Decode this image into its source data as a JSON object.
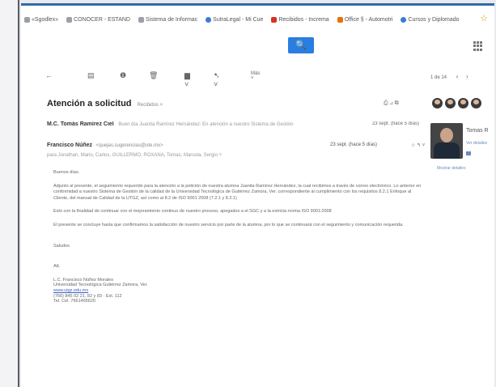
{
  "bookmarks": [
    {
      "label": "«Sgodlex»",
      "icon": "page-icon",
      "color": "#9aa0a6"
    },
    {
      "label": "CONOCER - ESTAND",
      "icon": "document-icon",
      "color": "#9aa0a6"
    },
    {
      "label": "Sistema de Informac",
      "icon": "page-icon",
      "color": "#9aa0a6"
    },
    {
      "label": "SutraLegal - Mi Cue",
      "icon": "globe-icon",
      "color": "#3c7bd4"
    },
    {
      "label": "Recibidos - tncrema",
      "icon": "gmail-icon",
      "color": "#d93025"
    },
    {
      "label": "Office § - Automotri",
      "icon": "office-icon",
      "color": "#e8710a"
    },
    {
      "label": "Cursos y Diplomado",
      "icon": "edu-icon",
      "color": "#3c7bd4"
    }
  ],
  "search": {
    "icon": "search-icon",
    "glyph": "🔍"
  },
  "toolbar": {
    "back": "←",
    "archive": "▤",
    "report": "❶",
    "delete": "🗑",
    "folder": "▆ ˅",
    "label": "➷ ˅",
    "more": "Más ˅"
  },
  "pager": {
    "text": "1 de 14",
    "prev": "‹",
    "next": "›"
  },
  "subject": {
    "title": "Atención a solicitud",
    "label": "Recibidos ×"
  },
  "subject_icons": "⎙ ⊿ ⧉",
  "message1": {
    "sender": "M.C. Tomás Ramírez Ciel",
    "snippet": "Buen día Juanita Ramírez Hernández: En atención a nuestro Sistema de Gestión",
    "date": "23 sept. (hace 5 días)"
  },
  "message2": {
    "sender": "Francisco Núñez",
    "address": "<quejas.sugerencias@ute.mx>",
    "date": "23 sept. (hace 5 días)",
    "actions": "☆ ↰ ˅",
    "to": "para Jonathan, Mario, Carlos, GUILLERMO, ROXANA, Tomas, Marcela, Sergio ˅"
  },
  "body": {
    "greeting": "Buenos días.",
    "p1": "Adjunto al presente, el seguimiento requerido para la atención a la petición de nuestra alumna Juanita Ramírez Hernández, la cual recibimos a través de correo electrónico. Lo anterior en conformidad a nuestro Sistema de Gestión de la calidad de la Universidad Tecnológica de Gutiérrez Zamora, Ver. correspondiente al cumplimiento con los requisitos 8.2.1 Enfoque al Cliente, del manual de Calidad de la UTGZ, así como al 8.2 de ISO 9001 2008 (7.2.1 y 8.2.1)",
    "p2": "Esto con la finalidad de continuar con el mejoramiento continuo de nuestro proceso, apegados a el SGC y a la estricta norma ISO 9001:2008",
    "p3": "El presente se concluye hasta que confirmamos la satisfacción de nuestro servicio por parte de la alumna, por lo que se continuará con el seguimiento y comunicación requerida.",
    "closing": "Saludos",
    "att": "Att.",
    "sig_name": "L.C. Francisco Núñez Morales",
    "sig_org": "Universidad Tecnológica Gutiérrez Zamora, Ver.",
    "sig_web": "www.utgz.edu.mx",
    "sig_phone": "(766) 845 02 21, 82 y 83 · Ext. 112",
    "sig_cel": "Tel. Cel. 7661465620"
  },
  "side": {
    "name": "Tomas R",
    "link": "Ver detalles",
    "page": "Mostrar detalles"
  },
  "colors": {
    "accent": "#2a7de1",
    "frame_border": "#2f6ba8"
  }
}
